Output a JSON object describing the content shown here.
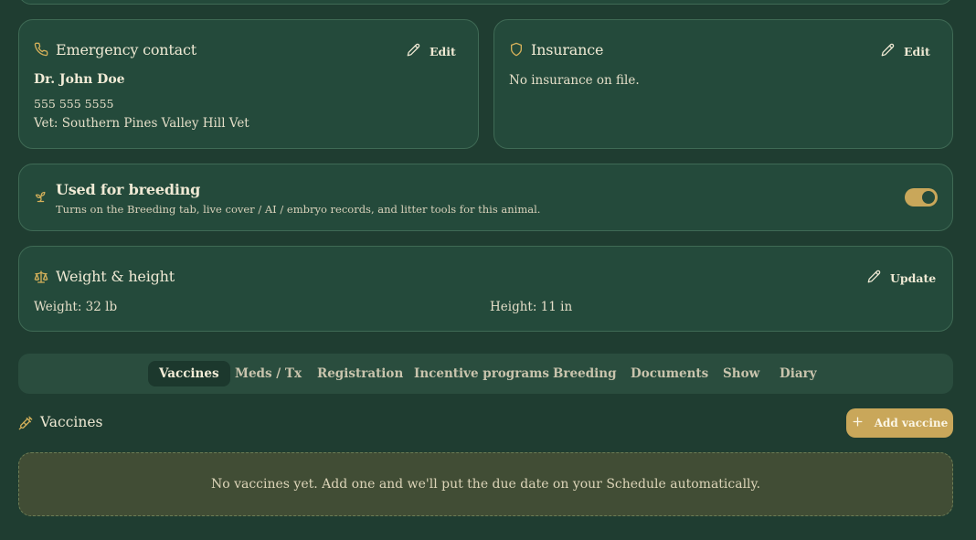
{
  "emergency": {
    "title": "Emergency contact",
    "edit_label": "Edit",
    "name": "Dr. John Doe",
    "phone": "555 555 5555",
    "vet": "Vet: Southern Pines Valley Hill Vet"
  },
  "insurance": {
    "title": "Insurance",
    "edit_label": "Edit",
    "empty_text": "No insurance on file."
  },
  "breeding": {
    "title": "Used for breeding",
    "description": "Turns on the Breeding tab, live cover / AI / embryo records, and litter tools for this animal.",
    "enabled": true
  },
  "measurements": {
    "title": "Weight & height",
    "update_label": "Update",
    "weight": "Weight: 32 lb",
    "height": "Height: 11 in"
  },
  "tabs": [
    {
      "label": "Vaccines",
      "active": true
    },
    {
      "label": "Meds / Tx",
      "active": false
    },
    {
      "label": "Registration",
      "active": false
    },
    {
      "label": "Incentive programs",
      "active": false
    },
    {
      "label": "Breeding",
      "active": false
    },
    {
      "label": "Documents",
      "active": false
    },
    {
      "label": "Show",
      "active": false
    },
    {
      "label": "Diary",
      "active": false
    }
  ],
  "vaccines": {
    "title": "Vaccines",
    "add_label": "Add vaccine",
    "empty_text": "No vaccines yet. Add one and we'll put the due date on your Schedule automatically."
  },
  "colors": {
    "background": "#1f3d31",
    "card": "#244a3b",
    "accent": "#c9a75a",
    "empty_box": "#414d35"
  },
  "icons": {
    "emergency": "phone-icon",
    "insurance": "shield-icon",
    "breeding": "sprout-icon",
    "measurements": "scale-icon",
    "edit": "pencil-icon",
    "vaccines": "syringe-icon",
    "add": "plus-icon"
  }
}
